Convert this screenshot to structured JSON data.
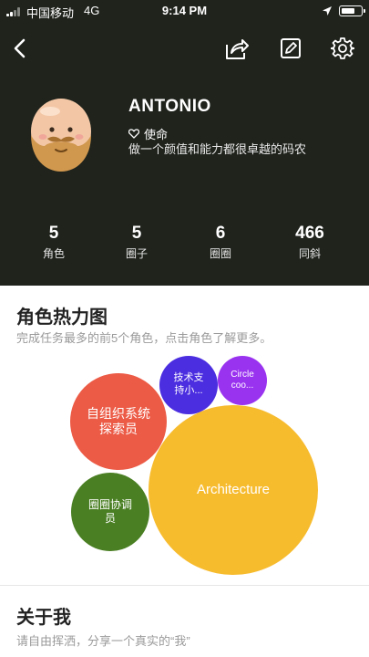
{
  "status_bar": {
    "carrier": "中国移动",
    "network": "4G",
    "time": "9:14 PM",
    "battery_level": 0.75
  },
  "nav": {
    "back_icon": "chevron-left-icon",
    "share_icon": "share-icon",
    "edit_icon": "edit-icon",
    "settings_icon": "gear-icon"
  },
  "profile": {
    "name": "ANTONIO",
    "motto_icon": "heart-outline-icon",
    "motto": "使命",
    "bio": "做一个颜值和能力都很卓越的码农"
  },
  "stats": [
    {
      "value": "5",
      "label": "角色"
    },
    {
      "value": "5",
      "label": "圈子"
    },
    {
      "value": "6",
      "label": "圈圈"
    },
    {
      "value": "466",
      "label": "同斜"
    }
  ],
  "heatmap": {
    "title": "角色热力图",
    "subtitle": "完成任务最多的前5个角色，点击角色了解更多。",
    "bubbles": [
      {
        "line1": "自组织系统",
        "line2": "探索员",
        "color": "#ec5b46"
      },
      {
        "line1": "技术支",
        "line2": "持小...",
        "color": "#4b2ee0"
      },
      {
        "line1": "Circle",
        "line2": "coo...",
        "color": "#9a33f0"
      },
      {
        "line1": "圈圈协调",
        "line2": "员",
        "color": "#4a7f23"
      },
      {
        "line1": "Architecture",
        "line2": "",
        "color": "#f7bb2e"
      }
    ]
  },
  "about": {
    "title": "关于我",
    "subtitle": "请自由挥洒，分享一个真实的“我”"
  }
}
